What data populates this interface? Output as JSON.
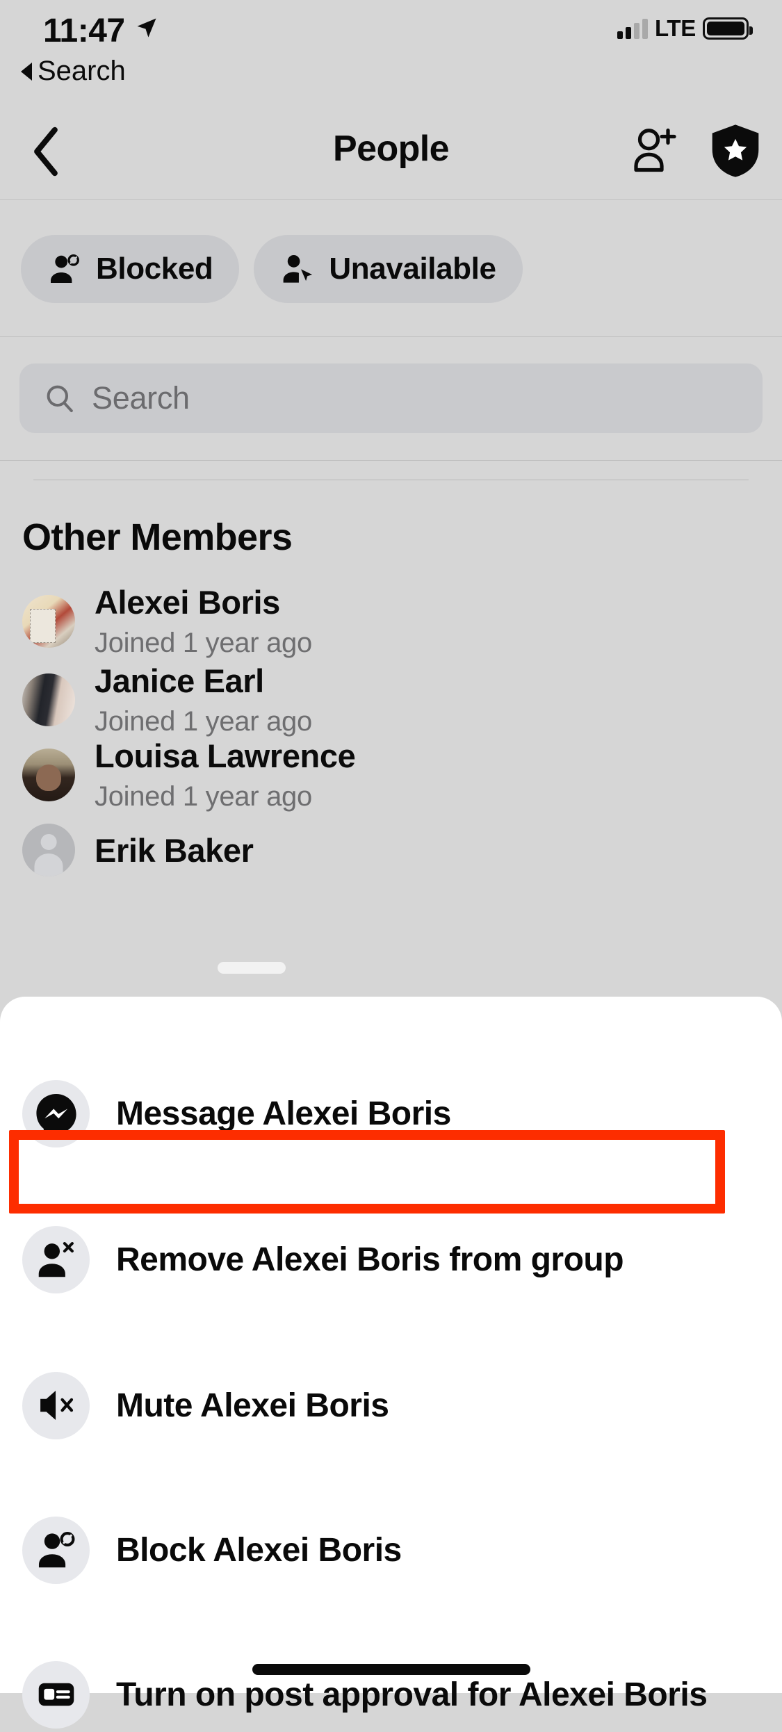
{
  "status_bar": {
    "time": "11:47",
    "location_icon": "location-arrow-icon",
    "carrier_tech": "LTE",
    "back_to_app_label": "Search",
    "signal_icon": "signal-bars-icon",
    "battery_icon": "battery-full-icon"
  },
  "nav": {
    "title": "People",
    "back_icon": "chevron-left-icon",
    "add_person_icon": "add-person-icon",
    "badge_icon": "shield-star-icon"
  },
  "filters": [
    {
      "label": "Blocked",
      "icon": "person-blocked-icon"
    },
    {
      "label": "Unavailable",
      "icon": "person-cursor-icon"
    }
  ],
  "search": {
    "placeholder": "Search",
    "value": "",
    "icon": "search-icon"
  },
  "members_section": {
    "title": "Other Members",
    "rows": [
      {
        "name": "Alexei Boris",
        "subtitle": "Joined 1 year ago",
        "avatar": "avatar"
      },
      {
        "name": "Janice Earl",
        "subtitle": "Joined 1 year ago",
        "avatar": "avatar"
      },
      {
        "name": "Louisa Lawrence",
        "subtitle": "Joined 1 year ago",
        "avatar": "avatar"
      },
      {
        "name": "Erik Baker",
        "subtitle": "",
        "avatar": "avatar-placeholder"
      }
    ]
  },
  "action_sheet": {
    "grabber": "sheet-grabber",
    "items": [
      {
        "label": "Message Alexei Boris",
        "icon": "messenger-icon"
      },
      {
        "label": "Remove Alexei Boris from group",
        "icon": "person-remove-icon"
      },
      {
        "label": "Mute Alexei Boris",
        "icon": "speaker-mute-icon"
      },
      {
        "label": "Block Alexei Boris",
        "icon": "person-blocked-icon"
      },
      {
        "label": "Turn on post approval for Alexei Boris",
        "icon": "post-approval-icon"
      }
    ]
  },
  "highlight": {
    "color": "#fd2d00",
    "target_label": "Remove Alexei Boris from group"
  },
  "home_indicator": "home-indicator"
}
